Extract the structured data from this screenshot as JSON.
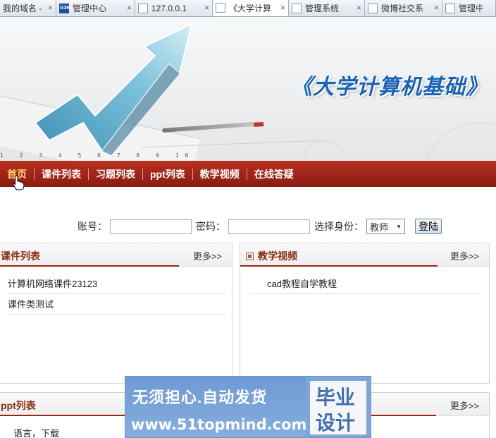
{
  "browser": {
    "tabs": [
      {
        "title": "我的域名 -",
        "active": false,
        "icon": "page-icon"
      },
      {
        "title": "管理中心",
        "active": false,
        "icon": "site-logo-icon",
        "favicon_text": "G361"
      },
      {
        "title": "127.0.0.1",
        "active": false,
        "icon": "page-icon"
      },
      {
        "title": "《大学计算",
        "active": true,
        "icon": "page-icon"
      },
      {
        "title": "管理系统",
        "active": false,
        "icon": "page-icon"
      },
      {
        "title": "微博社交系",
        "active": false,
        "icon": "page-icon"
      },
      {
        "title": "管理中心",
        "active": false,
        "icon": "page-icon"
      }
    ],
    "close_glyph": "×"
  },
  "banner": {
    "site_title": "《大学计算机基础》",
    "ruler_numbers": "1 2 3 4 5 6 7 8 9 10"
  },
  "nav": {
    "items": [
      {
        "label": "首页",
        "current": true
      },
      {
        "label": "课件列表",
        "current": false
      },
      {
        "label": "习题列表",
        "current": false
      },
      {
        "label": "ppt列表",
        "current": false
      },
      {
        "label": "教学视频",
        "current": false
      },
      {
        "label": "在线答疑",
        "current": false
      }
    ]
  },
  "login": {
    "account_label": "账号：",
    "account_value": "",
    "password_label": "密码：",
    "password_value": "",
    "role_label": "选择身份：",
    "role_selected": "教师",
    "submit_label": "登陆"
  },
  "panels": {
    "courseware": {
      "title": "课件列表",
      "more": "更多>>",
      "items": [
        "计算机网络课件23123",
        "课件类测试"
      ]
    },
    "video": {
      "title": "教学视频",
      "more": "更多>>",
      "items": [
        "cad教程自学教程"
      ]
    },
    "ppt": {
      "title": "ppt列表",
      "more": "更多>>",
      "items": [
        "语言，下载"
      ]
    }
  },
  "ad": {
    "line1": "无须担心.自动发货",
    "line2": "www.51topmind.com",
    "right_line1": "毕业",
    "right_line2": "设计"
  },
  "colors": {
    "nav_bg": "#a42817",
    "accent": "#9a2615",
    "title_blue": "#1a63b5",
    "ad_blue": "#7fa6d8"
  }
}
